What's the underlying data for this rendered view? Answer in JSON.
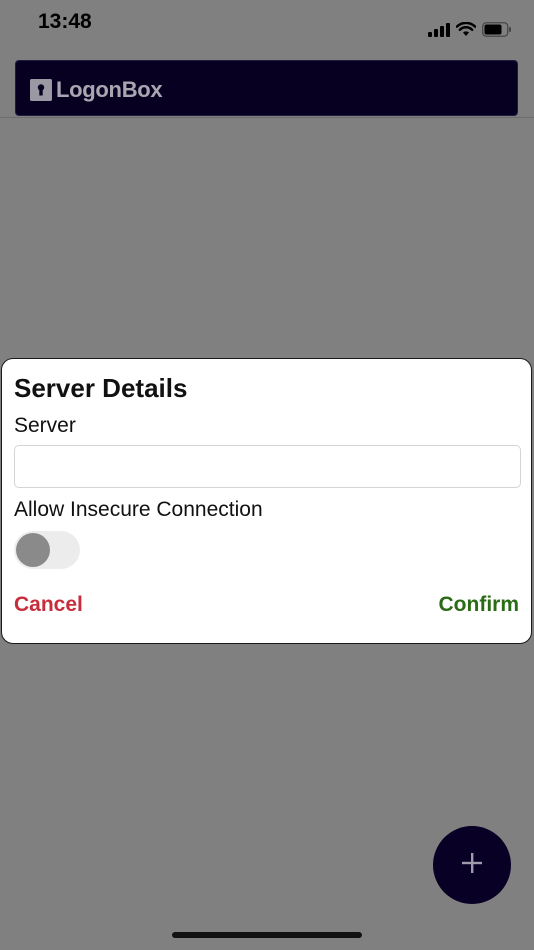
{
  "status_bar": {
    "time": "13:48",
    "icons": [
      "cellular-signal-icon",
      "wifi-icon",
      "battery-icon"
    ]
  },
  "header": {
    "logo_text": "LogonBox",
    "logo_icon": "keyhole-icon",
    "background": "#080020"
  },
  "dialog": {
    "title": "Server Details",
    "server_label": "Server",
    "server_value": "",
    "insecure_label": "Allow Insecure Connection",
    "insecure_enabled": false,
    "cancel_label": "Cancel",
    "confirm_label": "Confirm",
    "cancel_color": "#c82d3c",
    "confirm_color": "#2a6b16"
  },
  "fab": {
    "icon": "plus-icon",
    "background": "#090026"
  }
}
